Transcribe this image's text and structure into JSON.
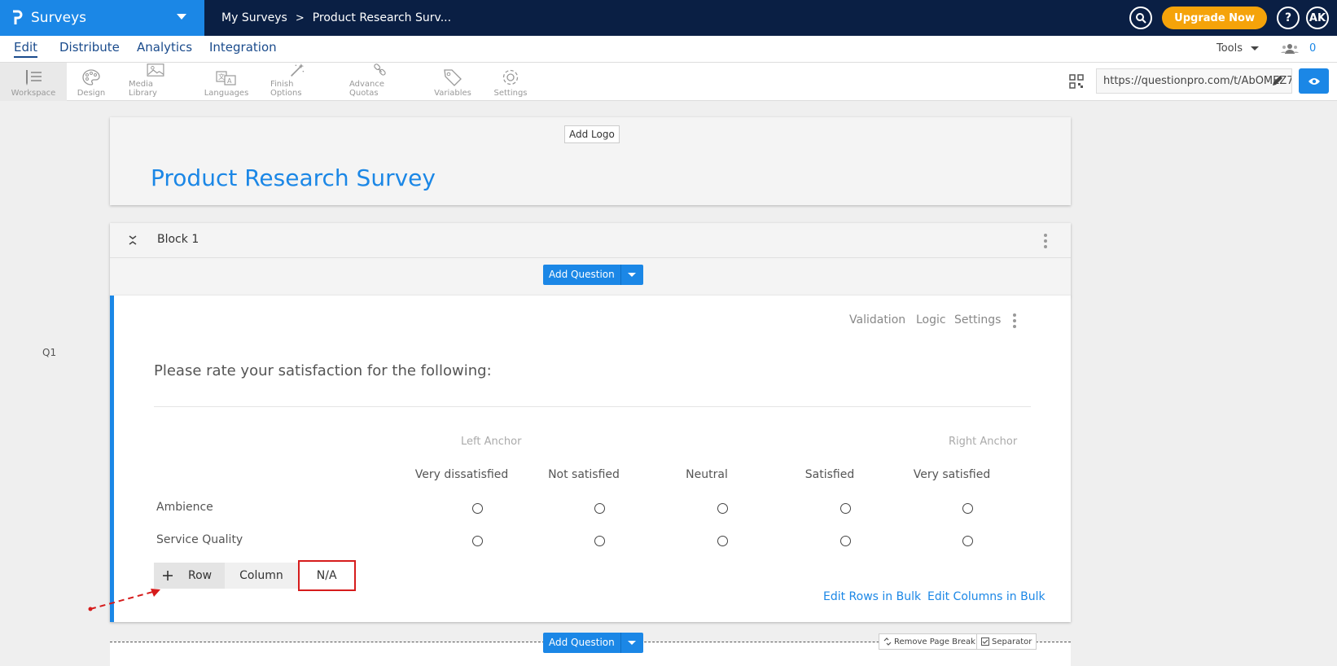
{
  "brand": {
    "app_name": "Surveys"
  },
  "breadcrumb": {
    "parent": "My Surveys",
    "separator": ">",
    "current": "Product Research Surv..."
  },
  "topbar": {
    "upgrade_label": "Upgrade Now",
    "help_label": "?",
    "avatar_initials": "AK"
  },
  "nav": {
    "tabs": [
      "Edit",
      "Distribute",
      "Analytics",
      "Integration"
    ],
    "active_tab": "Edit",
    "tools_label": "Tools",
    "collaborator_count": "0"
  },
  "toolbar": {
    "items": [
      {
        "label": "Workspace",
        "icon": "workspace-icon"
      },
      {
        "label": "Design",
        "icon": "palette-icon"
      },
      {
        "label": "Media Library",
        "icon": "image-icon"
      },
      {
        "label": "Languages",
        "icon": "languages-icon"
      },
      {
        "label": "Finish Options",
        "icon": "magic-wand-icon"
      },
      {
        "label": "Advance Quotas",
        "icon": "link-icon"
      },
      {
        "label": "Variables",
        "icon": "tag-icon"
      },
      {
        "label": "Settings",
        "icon": "gear-icon"
      }
    ],
    "survey_url": "https://questionpro.com/t/AbOMEZ7"
  },
  "header": {
    "add_logo_label": "Add Logo",
    "survey_title": "Product Research Survey"
  },
  "block": {
    "title": "Block 1",
    "add_question_label": "Add Question"
  },
  "question": {
    "number": "Q1",
    "links": [
      "Validation",
      "Logic",
      "Settings"
    ],
    "text": "Please rate your satisfaction for the following:",
    "left_anchor": "Left Anchor",
    "right_anchor": "Right Anchor",
    "columns": [
      "Very dissatisfied",
      "Not satisfied",
      "Neutral",
      "Satisfied",
      "Very satisfied"
    ],
    "rows": [
      "Ambience",
      "Service Quality"
    ],
    "add_row_label": "Row",
    "add_column_label": "Column",
    "add_na_label": "N/A",
    "edit_rows_bulk": "Edit Rows in Bulk",
    "edit_columns_bulk": "Edit Columns in Bulk"
  },
  "footer": {
    "add_question_label": "Add Question",
    "remove_page_break_label": "Remove Page Break",
    "separator_label": "Separator"
  },
  "colors": {
    "brand_blue": "#1b87e6",
    "topbar_navy": "#0a1f44",
    "upgrade_orange": "#f5a30a",
    "highlight_red": "#d61c1c"
  }
}
